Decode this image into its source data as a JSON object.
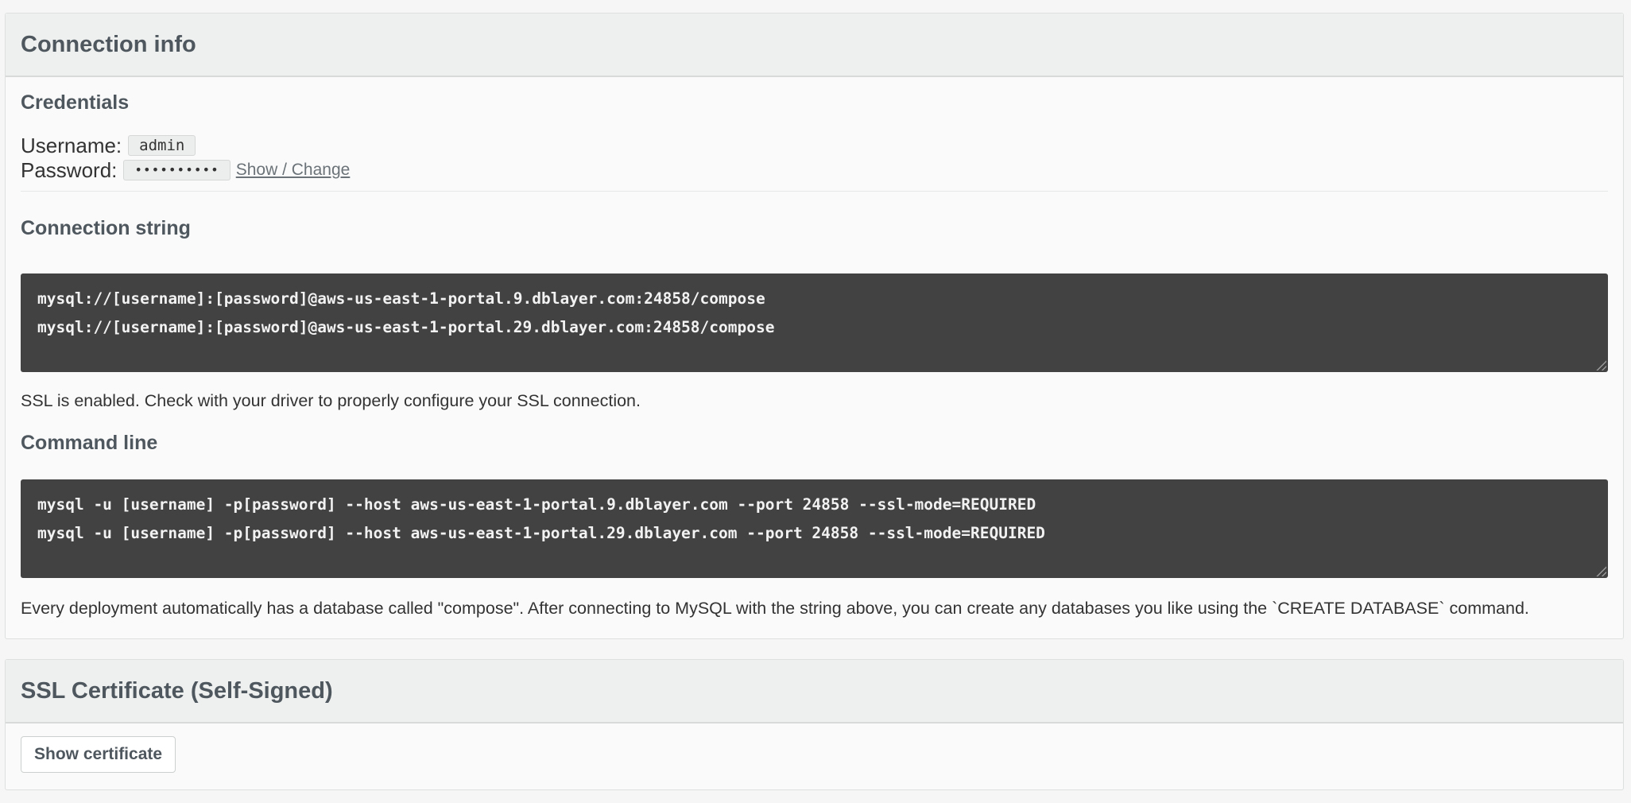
{
  "connection_panel": {
    "title": "Connection info",
    "credentials": {
      "heading": "Credentials",
      "username_label": "Username:",
      "username_value": "admin",
      "password_label": "Password:",
      "password_masked": "••••••••••",
      "show_change_link": "Show / Change"
    },
    "connection_string": {
      "heading": "Connection string",
      "lines": [
        "mysql://[username]:[password]@aws-us-east-1-portal.9.dblayer.com:24858/compose",
        "mysql://[username]:[password]@aws-us-east-1-portal.29.dblayer.com:24858/compose"
      ],
      "ssl_note": "SSL is enabled. Check with your driver to properly configure your SSL connection."
    },
    "command_line": {
      "heading": "Command line",
      "lines": [
        "mysql -u [username] -p[password] --host aws-us-east-1-portal.9.dblayer.com --port 24858 --ssl-mode=REQUIRED",
        "mysql -u [username] -p[password] --host aws-us-east-1-portal.29.dblayer.com --port 24858 --ssl-mode=REQUIRED"
      ],
      "note": "Every deployment automatically has a database called \"compose\". After connecting to MySQL with the string above, you can create any databases you like using the `CREATE DATABASE` command."
    }
  },
  "ssl_panel": {
    "title": "SSL Certificate (Self-Signed)",
    "show_certificate_button": "Show certificate"
  }
}
